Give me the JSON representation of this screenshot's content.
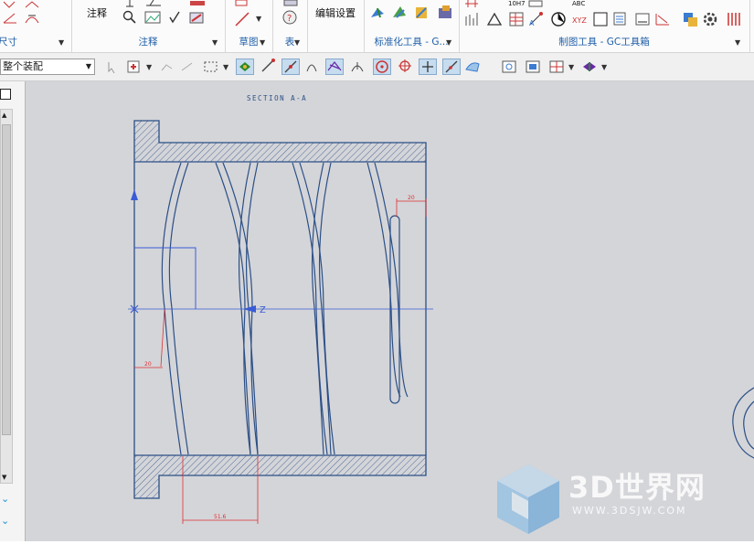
{
  "ribbon": {
    "groups": [
      {
        "label": "尺寸"
      },
      {
        "label": "注释",
        "big_button": "注释"
      },
      {
        "label": "草图"
      },
      {
        "label": "表"
      },
      {
        "label": "",
        "big_button": "编辑设置"
      },
      {
        "label": "标准化工具 - G..."
      },
      {
        "label": "制图工具 - GC工具箱"
      }
    ],
    "icon_labels": {
      "fit": "10H7",
      "abc": "ABC",
      "xyz": "XYZ"
    }
  },
  "toolbar": {
    "filter_combo": "整个装配"
  },
  "drawing": {
    "section_title": "SECTION  A-A",
    "axis_label": "Z",
    "dim_top_right": "20",
    "dim_left": "20",
    "dim_bottom": "51.6",
    "line_color": "#2b4f86",
    "dim_color": "#e03030",
    "axis_color": "#3a5bd6"
  },
  "watermark": {
    "brand": "3D世界网",
    "url": "WWW.3DSJW.COM"
  }
}
